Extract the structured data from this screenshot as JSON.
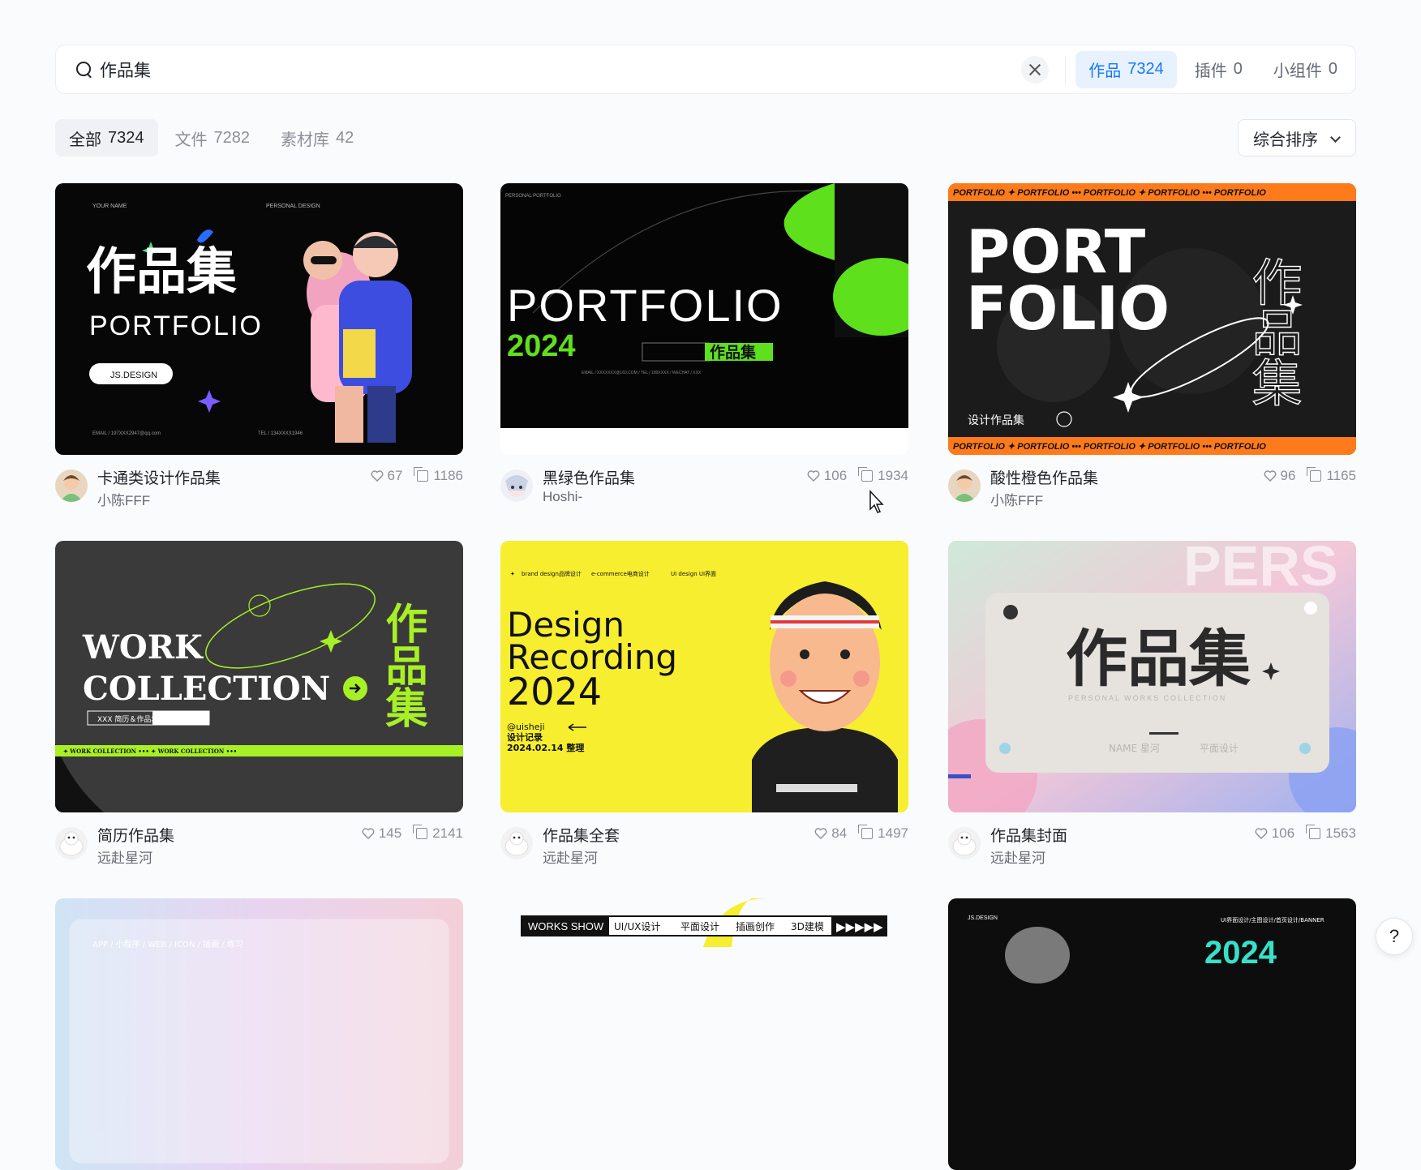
{
  "search": {
    "value": "作品集",
    "tabs": [
      {
        "label": "作品",
        "count": "7324"
      },
      {
        "label": "插件",
        "count": "0"
      },
      {
        "label": "小组件",
        "count": "0"
      }
    ]
  },
  "filters": {
    "tabs": [
      {
        "label": "全部",
        "count": "7324"
      },
      {
        "label": "文件",
        "count": "7282"
      },
      {
        "label": "素材库",
        "count": "42"
      }
    ],
    "sort_label": "综合排序"
  },
  "cards": [
    {
      "title": "卡通类设计作品集",
      "author": "小陈FFF",
      "likes": "67",
      "copies": "1186"
    },
    {
      "title": "黑绿色作品集",
      "author": "Hoshi-",
      "likes": "106",
      "copies": "1934"
    },
    {
      "title": "酸性橙色作品集",
      "author": "小陈FFF",
      "likes": "96",
      "copies": "1165"
    },
    {
      "title": "简历作品集",
      "author": "远赴星河",
      "likes": "145",
      "copies": "2141"
    },
    {
      "title": "作品集全套",
      "author": "远赴星河",
      "likes": "84",
      "copies": "1497"
    },
    {
      "title": "作品集封面",
      "author": "远赴星河",
      "likes": "106",
      "copies": "1563"
    }
  ],
  "thumbs": {
    "t1": {
      "tag_left": "YOUR NAME",
      "tag_right": "PERSONAL DESIGN",
      "cn": "作品集",
      "en": "PORTFOLIO",
      "pill": "JS.DESIGN"
    },
    "t2": {
      "tag": "PERSONAL PORTFOLIO",
      "en": "PORTFOLIO",
      "year": "2024",
      "cn": "作品集"
    },
    "t3": {
      "band": "PORTFOLIO ✦ PORTFOLIO ••• PORTFOLIO ✦ PORTFOLIO ••• PORTFOLIO",
      "l1": "PORT",
      "l2": "FOLIO",
      "sub": "设计作品集",
      "side": "作品集"
    },
    "t4": {
      "l1": "WORK",
      "l2": "COLLECTION",
      "tag": "XXX  简历＆作品集",
      "band": "✦ WORK COLLECTION ••• ✦ WORK COLLECTION •••",
      "side": "作品集"
    },
    "t5": {
      "top1": "brand design品牌设计",
      "top2": "e-commerce电商设计",
      "top3": "UI design UI界面",
      "l1": "Design",
      "l2": "Recording",
      "l3": "2024",
      "tag1": "@uisheji",
      "tag2": "设计记录",
      "tag3": "2024.02.14 整理"
    },
    "t6": {
      "cn": "作品集",
      "sub": "PERSONAL WORKS COLLECTION",
      "name": "NAME 星河",
      "role": "平面设计",
      "bg": "PERS"
    },
    "t7": {
      "text": "APP / 小程序 / WEB / ICON / 插画 / 练习"
    },
    "t8": {
      "items": [
        "WORKS SHOW",
        "UI/UX设计",
        "平面设计",
        "插画创作",
        "3D建模"
      ]
    },
    "t9": {
      "tag": "JS.DESIGN",
      "tag2": "UI界面设计/主图设计/首页设计/BANNER",
      "year": "2024"
    }
  },
  "help_label": "?"
}
